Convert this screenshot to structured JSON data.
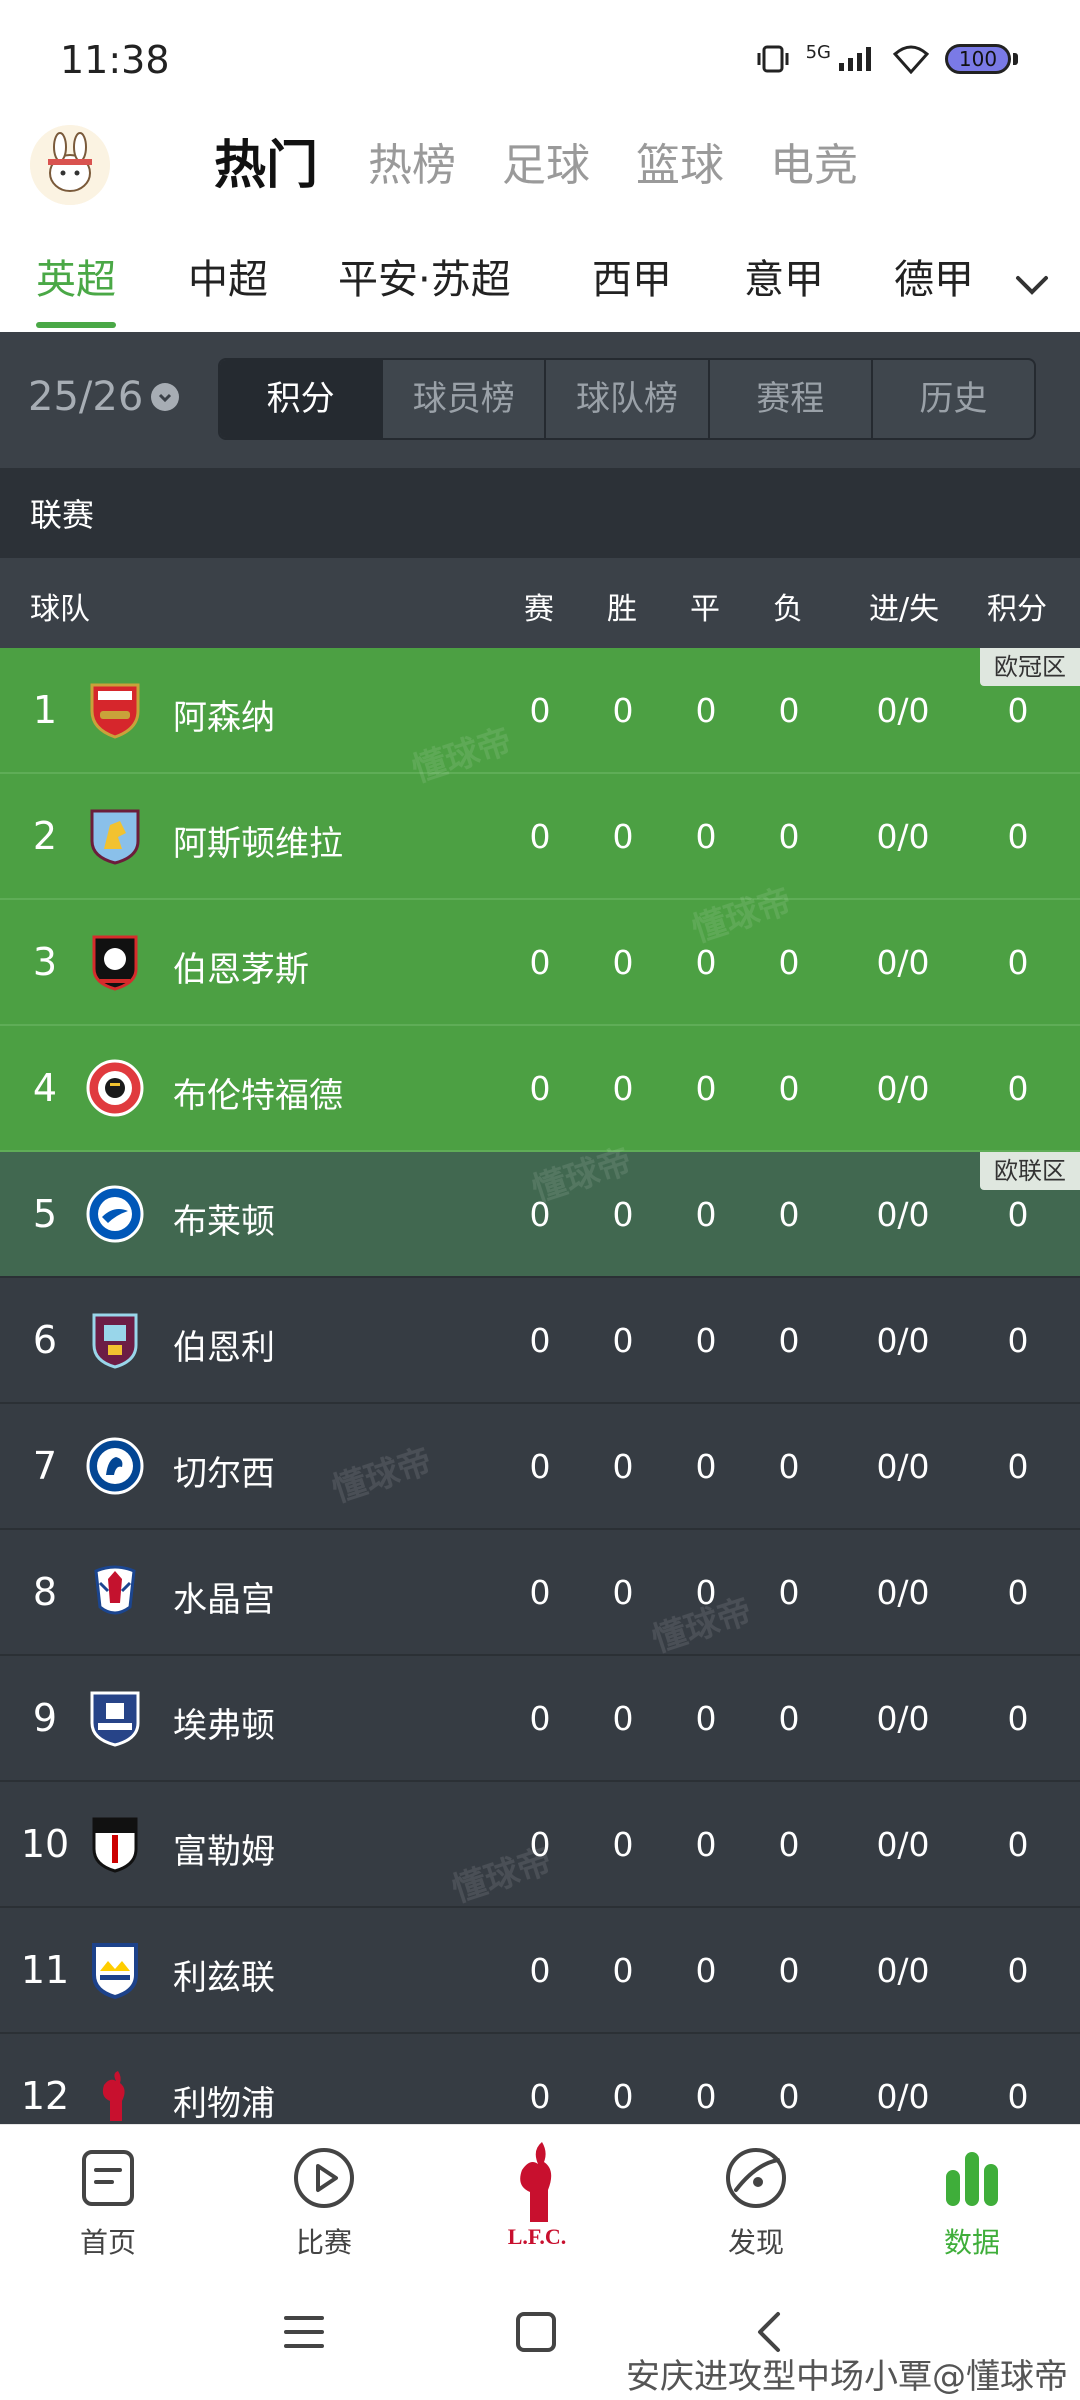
{
  "status_bar": {
    "time": "11:38",
    "network": "5G",
    "battery": "100"
  },
  "top_tabs": [
    {
      "label": "热门",
      "active": true
    },
    {
      "label": "热榜",
      "active": false
    },
    {
      "label": "足球",
      "active": false
    },
    {
      "label": "篮球",
      "active": false
    },
    {
      "label": "电竞",
      "active": false
    }
  ],
  "league_tabs": [
    {
      "label": "英超",
      "active": true
    },
    {
      "label": "中超",
      "active": false
    },
    {
      "label": "平安·苏超",
      "active": false
    },
    {
      "label": "西甲",
      "active": false
    },
    {
      "label": "意甲",
      "active": false
    },
    {
      "label": "德甲",
      "active": false
    }
  ],
  "season": "25/26",
  "segment_tabs": [
    {
      "label": "积分",
      "active": true
    },
    {
      "label": "球员榜",
      "active": false
    },
    {
      "label": "球队榜",
      "active": false
    },
    {
      "label": "赛程",
      "active": false
    },
    {
      "label": "历史",
      "active": false
    }
  ],
  "section_label": "联赛",
  "columns": {
    "team": "球队",
    "played": "赛",
    "won": "胜",
    "drawn": "平",
    "lost": "负",
    "goals": "进/失",
    "points": "积分"
  },
  "zones": {
    "ucl": "欧冠区",
    "uel": "欧联区"
  },
  "standings": [
    {
      "rank": "1",
      "team": "阿森纳",
      "crest": "arsenal-crest",
      "played": "0",
      "won": "0",
      "drawn": "0",
      "lost": "0",
      "goals": "0/0",
      "points": "0"
    },
    {
      "rank": "2",
      "team": "阿斯顿维拉",
      "crest": "aston-villa-crest",
      "played": "0",
      "won": "0",
      "drawn": "0",
      "lost": "0",
      "goals": "0/0",
      "points": "0"
    },
    {
      "rank": "3",
      "team": "伯恩茅斯",
      "crest": "bournemouth-crest",
      "played": "0",
      "won": "0",
      "drawn": "0",
      "lost": "0",
      "goals": "0/0",
      "points": "0"
    },
    {
      "rank": "4",
      "team": "布伦特福德",
      "crest": "brentford-crest",
      "played": "0",
      "won": "0",
      "drawn": "0",
      "lost": "0",
      "goals": "0/0",
      "points": "0"
    },
    {
      "rank": "5",
      "team": "布莱顿",
      "crest": "brighton-crest",
      "played": "0",
      "won": "0",
      "drawn": "0",
      "lost": "0",
      "goals": "0/0",
      "points": "0"
    },
    {
      "rank": "6",
      "team": "伯恩利",
      "crest": "burnley-crest",
      "played": "0",
      "won": "0",
      "drawn": "0",
      "lost": "0",
      "goals": "0/0",
      "points": "0"
    },
    {
      "rank": "7",
      "team": "切尔西",
      "crest": "chelsea-crest",
      "played": "0",
      "won": "0",
      "drawn": "0",
      "lost": "0",
      "goals": "0/0",
      "points": "0"
    },
    {
      "rank": "8",
      "team": "水晶宫",
      "crest": "crystal-palace-crest",
      "played": "0",
      "won": "0",
      "drawn": "0",
      "lost": "0",
      "goals": "0/0",
      "points": "0"
    },
    {
      "rank": "9",
      "team": "埃弗顿",
      "crest": "everton-crest",
      "played": "0",
      "won": "0",
      "drawn": "0",
      "lost": "0",
      "goals": "0/0",
      "points": "0"
    },
    {
      "rank": "10",
      "team": "富勒姆",
      "crest": "fulham-crest",
      "played": "0",
      "won": "0",
      "drawn": "0",
      "lost": "0",
      "goals": "0/0",
      "points": "0"
    },
    {
      "rank": "11",
      "team": "利兹联",
      "crest": "leeds-crest",
      "played": "0",
      "won": "0",
      "drawn": "0",
      "lost": "0",
      "goals": "0/0",
      "points": "0"
    },
    {
      "rank": "12",
      "team": "利物浦",
      "crest": "liverpool-crest",
      "played": "0",
      "won": "0",
      "drawn": "0",
      "lost": "0",
      "goals": "0/0",
      "points": "0"
    }
  ],
  "watermark": "懂球帝",
  "bottom_nav": [
    {
      "label": "首页",
      "icon": "home-doc-icon",
      "active": false
    },
    {
      "label": "比赛",
      "icon": "play-icon",
      "active": false
    },
    {
      "label": "",
      "icon": "liverpool-lfc-icon",
      "active": false
    },
    {
      "label": "发现",
      "icon": "discover-icon",
      "active": false
    },
    {
      "label": "数据",
      "icon": "data-bars-icon",
      "active": true
    }
  ],
  "caption": "安庆进攻型中场小覃@懂球帝",
  "colors": {
    "accent_green": "#4aa846",
    "ucl_row": "#4ca043",
    "uel_row": "#416850",
    "row_dark": "#363c43"
  }
}
